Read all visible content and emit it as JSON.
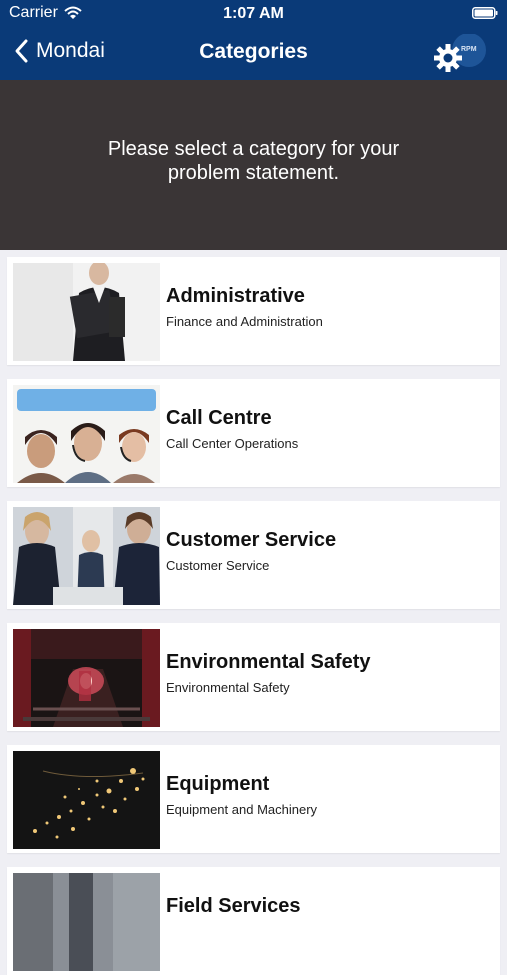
{
  "status_bar": {
    "carrier": "Carrier",
    "time": "1:07 AM",
    "wifi_icon": "wifi-icon",
    "battery_icon": "battery-icon"
  },
  "nav": {
    "back_label": "Mondai",
    "title": "Categories",
    "settings_icon": "gear-icon",
    "settings_badge": "RPM"
  },
  "banner": {
    "text": "Please select a category for your problem statement."
  },
  "categories": [
    {
      "title": "Administrative",
      "subtitle": "Finance and Administration"
    },
    {
      "title": "Call Centre",
      "subtitle": "Call Center Operations"
    },
    {
      "title": "Customer Service",
      "subtitle": "Customer Service"
    },
    {
      "title": "Environmental Safety",
      "subtitle": "Environmental Safety"
    },
    {
      "title": "Equipment",
      "subtitle": "Equipment and Machinery"
    },
    {
      "title": "Field Services",
      "subtitle": ""
    }
  ],
  "colors": {
    "nav_bg": "#0a3a78",
    "banner_bg": "#3a3536",
    "list_bg": "#efeff4",
    "card_bg": "#ffffff"
  }
}
